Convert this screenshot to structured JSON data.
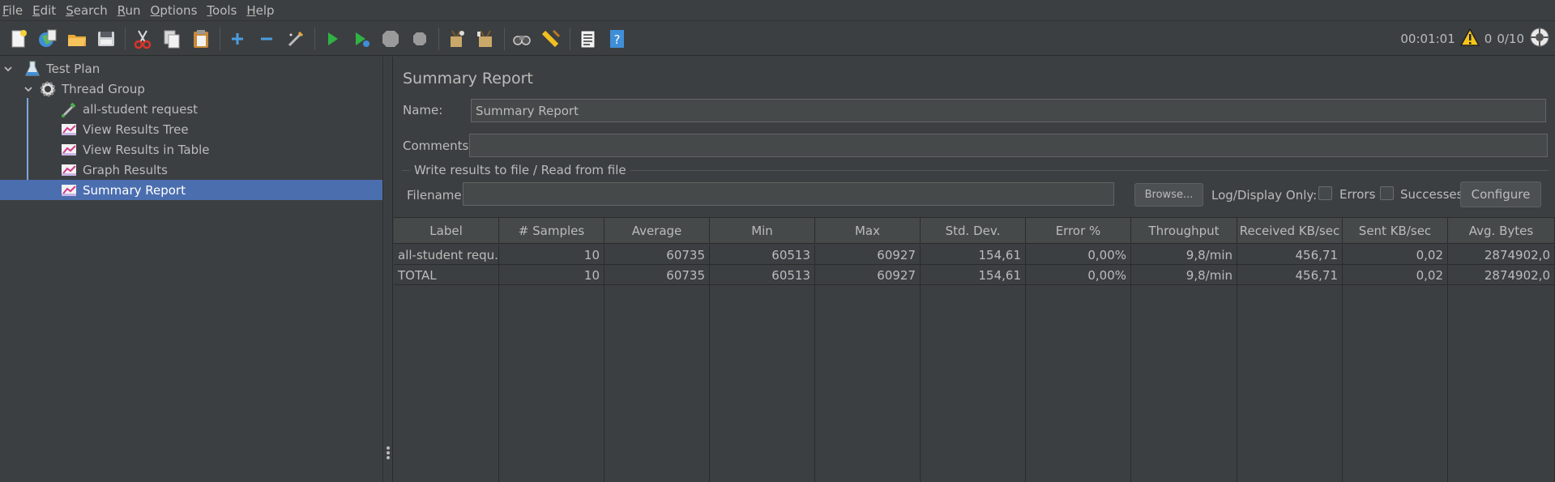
{
  "menu": [
    {
      "mnemonic": "F",
      "rest": "ile"
    },
    {
      "mnemonic": "E",
      "rest": "dit"
    },
    {
      "mnemonic": "S",
      "rest": "earch"
    },
    {
      "mnemonic": "R",
      "rest": "un"
    },
    {
      "mnemonic": "O",
      "rest": "ptions"
    },
    {
      "mnemonic": "T",
      "rest": "ools"
    },
    {
      "mnemonic": "H",
      "rest": "elp"
    }
  ],
  "toolbar": {
    "icons": [
      "new-icon",
      "templates-icon",
      "open-icon",
      "save-icon",
      "cut-icon",
      "copy-icon",
      "paste-icon",
      "expand-icon",
      "collapse-icon",
      "toggle-icon",
      "start-icon",
      "start-no-pauses-icon",
      "stop-icon",
      "shutdown-icon",
      "clear-icon",
      "clear-all-icon",
      "search-icon",
      "reset-search-icon",
      "function-helper-icon",
      "help-icon"
    ],
    "elapsed": "00:01:01",
    "warnings": "0",
    "threads": "0/10"
  },
  "tree": {
    "items": [
      {
        "label": "Test Plan",
        "icon": "flask-icon"
      },
      {
        "label": "Thread Group",
        "icon": "gear-icon"
      },
      {
        "label": "all-student request",
        "icon": "sampler-pipette-icon"
      },
      {
        "label": "View Results Tree",
        "icon": "listener-chart-icon"
      },
      {
        "label": "View Results in Table",
        "icon": "listener-chart-icon"
      },
      {
        "label": "Graph Results",
        "icon": "listener-chart-icon"
      },
      {
        "label": "Summary Report",
        "icon": "listener-chart-icon"
      }
    ]
  },
  "panel": {
    "title": "Summary Report",
    "name_label": "Name:",
    "name_value": "Summary Report",
    "comments_label": "Comments:",
    "comments_value": "",
    "file_group_label": "Write results to file / Read from file",
    "filename_label": "Filename",
    "filename_value": "",
    "browse_label": "Browse...",
    "log_display_label": "Log/Display Only:",
    "errors_label": "Errors",
    "successes_label": "Successes",
    "configure_label": "Configure"
  },
  "table": {
    "columns": [
      "Label",
      "# Samples",
      "Average",
      "Min",
      "Max",
      "Std. Dev.",
      "Error %",
      "Throughput",
      "Received KB/sec",
      "Sent KB/sec",
      "Avg. Bytes"
    ],
    "rows": [
      [
        "all-student requ...",
        "10",
        "60735",
        "60513",
        "60927",
        "154,61",
        "0,00%",
        "9,8/min",
        "456,71",
        "0,02",
        "2874902,0"
      ],
      [
        "TOTAL",
        "10",
        "60735",
        "60513",
        "60927",
        "154,61",
        "0,00%",
        "9,8/min",
        "456,71",
        "0,02",
        "2874902,0"
      ]
    ]
  },
  "colors": {
    "background": "#3c3f41",
    "selection": "#4b6eaf",
    "text": "#bbbbbb",
    "tree_line": "#7ba7e0"
  }
}
